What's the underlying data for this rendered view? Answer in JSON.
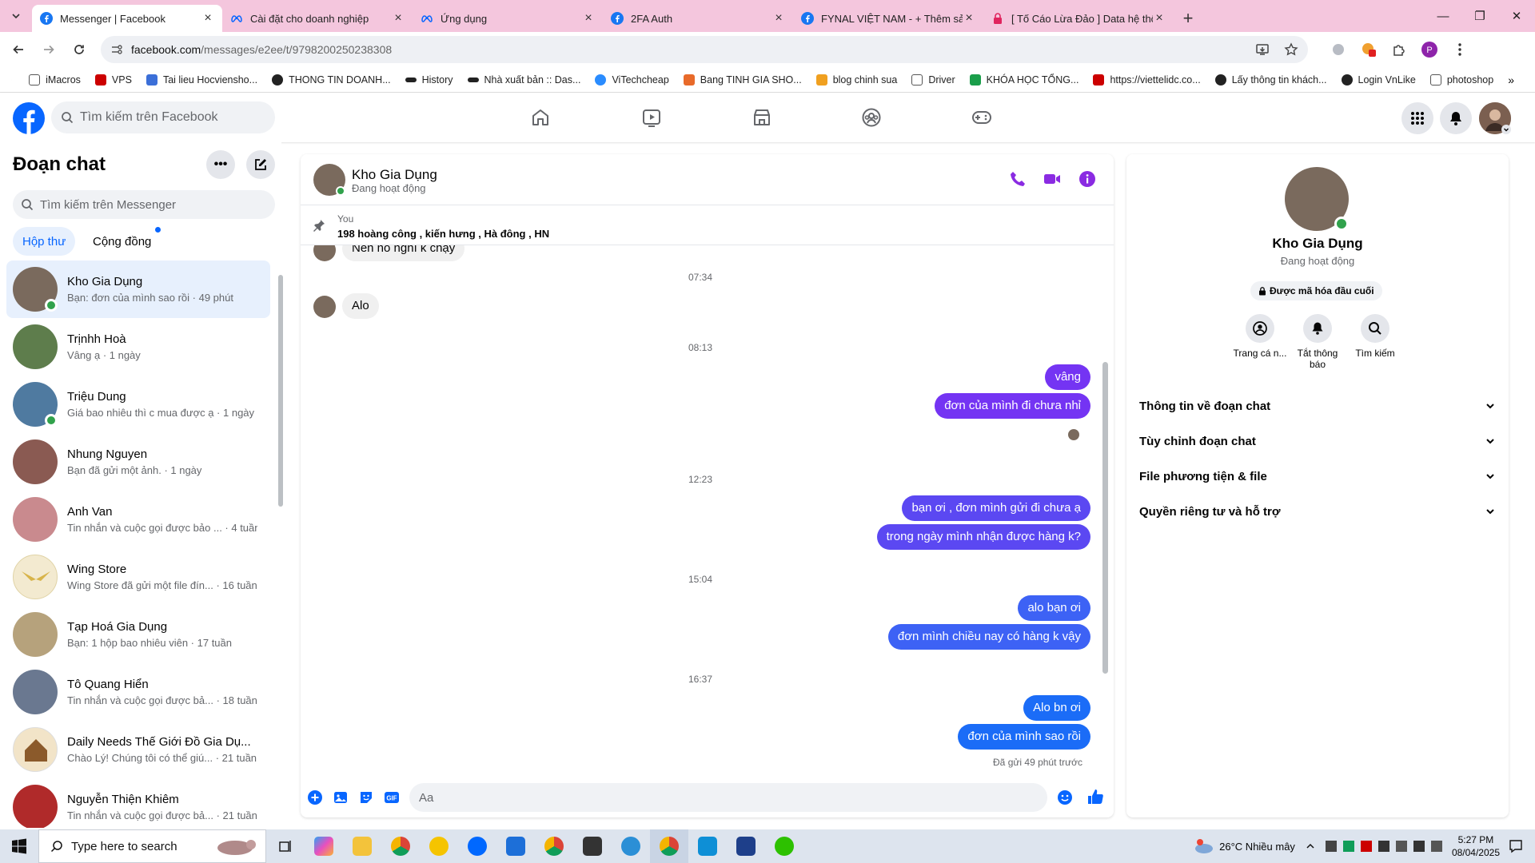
{
  "browser": {
    "tabs": [
      {
        "title": "Messenger | Facebook",
        "icon": "facebook-icon",
        "color": "#1877f2"
      },
      {
        "title": "Cài đặt cho doanh nghiệp",
        "icon": "meta-icon",
        "color": "#0866ff"
      },
      {
        "title": "Ứng dụng",
        "icon": "meta-icon",
        "color": "#0866ff"
      },
      {
        "title": "2FA Auth",
        "icon": "facebook-icon",
        "color": "#1877f2"
      },
      {
        "title": "FYNAL VIỆT NAM - + Thêm sản",
        "icon": "facebook-icon",
        "color": "#1877f2"
      },
      {
        "title": "[ Tố Cáo Lừa Đảo ] Data hệ thốn",
        "icon": "lock-icon",
        "color": "#e0245e"
      }
    ],
    "url_site": "facebook.com",
    "url_path": "/messages/e2ee/t/9798200250238308",
    "bookmarks": [
      "iMacros",
      "VPS",
      "Tai lieu Hocviensho...",
      "THONG TIN DOANH...",
      "History",
      "Nhà xuất bản :: Das...",
      "ViTechcheap",
      "Bang TINH GIA SHO...",
      "blog chinh sua",
      "Driver",
      "KHÓA HỌC TỔNG...",
      "https://viettelidc.co...",
      "Lấy thông tin khách...",
      "Login VnLike",
      "photoshop"
    ]
  },
  "facebook": {
    "search_placeholder": "Tìm kiếm trên Facebook"
  },
  "sidebar": {
    "title": "Đoạn chat",
    "search_placeholder": "Tìm kiếm trên Messenger",
    "tab_inbox": "Hộp thư",
    "tab_community": "Cộng đồng",
    "chats": [
      {
        "name": "Kho Gia Dụng",
        "preview": "Bạn: đơn của mình sao rồi · 49 phút",
        "online": true,
        "selected": true,
        "color": "#7a6a5d"
      },
      {
        "name": "Trịnhh Hoà",
        "preview": "Vâng ạ · 1 ngày",
        "online": false,
        "color": "#5e7d4c"
      },
      {
        "name": "Triệu Dung",
        "preview": "Giá bao nhiêu thì c mua được ạ · 1 ngày",
        "online": true,
        "color": "#4f7aa0"
      },
      {
        "name": "Nhung Nguyen",
        "preview": "Bạn đã gửi một ảnh. · 1 ngày",
        "online": false,
        "color": "#8a5a52"
      },
      {
        "name": "Anh Van",
        "preview": "Tin nhắn và cuộc gọi được bảo ... · 4 tuần",
        "online": false,
        "color": "#c98a8e"
      },
      {
        "name": "Wing Store",
        "preview": "Wing Store đã gửi một file đín... · 16 tuần",
        "online": false,
        "color": "#d8b44a"
      },
      {
        "name": "Tạp Hoá Gia Dụng",
        "preview": "Bạn: 1 hộp bao nhiêu viên · 17 tuần",
        "online": false,
        "color": "#b6a27c"
      },
      {
        "name": "Tô Quang Hiển",
        "preview": "Tin nhắn và cuộc gọi được bả... · 18 tuần",
        "online": false,
        "color": "#6a7890"
      },
      {
        "name": "Daily Needs Thế Giới Đồ Gia Dụ...",
        "preview": "Chào Lý! Chúng tôi có thể giú... · 21 tuần",
        "online": false,
        "color": "#8b5a2b"
      },
      {
        "name": "Nguyễn Thiện Khiêm",
        "preview": "Tin nhắn và cuộc gọi được bả... · 21 tuần",
        "online": false,
        "color": "#b02a2a"
      }
    ]
  },
  "conversation": {
    "name": "Kho Gia Dụng",
    "status": "Đang hoạt động",
    "pinned_from": "You",
    "pinned_text": "198 hoàng công , kiến hưng , Hà đông , HN",
    "timestamps": [
      "07:34",
      "08:13",
      "12:23",
      "15:04",
      "16:37"
    ],
    "messages_in": [
      "Nên nó nghĩ k chạy",
      "Alo"
    ],
    "messages_out": [
      "vâng",
      "đơn của mình đi chưa nhỉ",
      "bạn ơi , đơn mình gửi đi chưa ạ",
      "trong ngày mình nhận được hàng k?",
      "alo bạn ơi",
      "đơn mình chiều nay có hàng k vậy",
      "Alo bn ơi",
      "đơn của mình sao rồi"
    ],
    "sent_status": "Đã gửi 49 phút trước",
    "input_placeholder": "Aa"
  },
  "info_panel": {
    "name": "Kho Gia Dụng",
    "status": "Đang hoạt động",
    "encryption": "Được mã hóa đầu cuối",
    "actions": [
      {
        "label": "Trang cá n...",
        "icon": "profile-icon"
      },
      {
        "label": "Tắt thông báo",
        "icon": "bell-icon"
      },
      {
        "label": "Tìm kiếm",
        "icon": "search-icon"
      }
    ],
    "sections": [
      "Thông tin về đoạn chat",
      "Tùy chỉnh đoạn chat",
      "File phương tiện & file",
      "Quyền riêng tư và hỗ trợ"
    ]
  },
  "taskbar": {
    "search_placeholder": "Type here to search",
    "weather": "26°C  Nhiều mây",
    "time": "5:27 PM",
    "date": "08/04/2025"
  },
  "colors": {
    "brand": "#0866ff",
    "bubble_purple": "#7434f3",
    "bubble_blue": "#3d62f5",
    "tabbar": "#f4c6dd"
  }
}
